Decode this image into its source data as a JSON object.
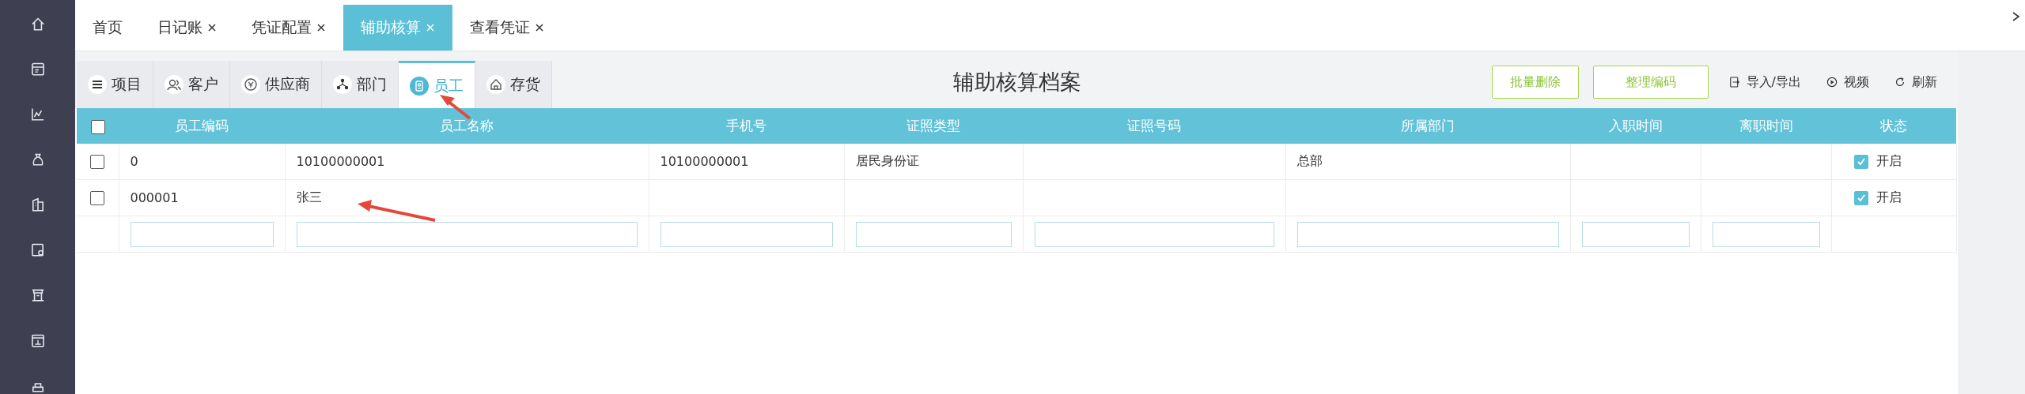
{
  "tabs": [
    {
      "label": "首页",
      "selected": false,
      "closable": false
    },
    {
      "label": "日记账",
      "selected": false,
      "closable": true
    },
    {
      "label": "凭证配置",
      "selected": false,
      "closable": true
    },
    {
      "label": "辅助核算",
      "selected": true,
      "closable": true
    },
    {
      "label": "查看凭证",
      "selected": false,
      "closable": true
    }
  ],
  "subtabs": [
    {
      "label": "项目",
      "selected": false
    },
    {
      "label": "客户",
      "selected": false
    },
    {
      "label": "供应商",
      "selected": false
    },
    {
      "label": "部门",
      "selected": false
    },
    {
      "label": "员工",
      "selected": true
    },
    {
      "label": "存货",
      "selected": false
    }
  ],
  "title": "辅助核算档案",
  "buttons": [
    {
      "label": "批量删除"
    },
    {
      "label": "整理编码"
    }
  ],
  "links": [
    {
      "label": "导入/导出"
    },
    {
      "label": "视频"
    },
    {
      "label": "刷新"
    }
  ],
  "table": {
    "all_checked": false,
    "columns": [
      "员工编码",
      "员工名称",
      "手机号",
      "证照类型",
      "证照号码",
      "所属部门",
      "入职时间",
      "离职时间",
      "状态"
    ],
    "rows": [
      {
        "checked": false,
        "cells": [
          "0",
          "10100000001",
          "10100000001",
          "居民身份证",
          "",
          "总部",
          "",
          ""
        ],
        "status": {
          "checked": true,
          "label": "开启"
        }
      },
      {
        "checked": false,
        "cells": [
          "000001",
          "张三",
          "",
          "",
          "",
          "",
          "",
          ""
        ],
        "status": {
          "checked": true,
          "label": "开启"
        }
      }
    ]
  }
}
